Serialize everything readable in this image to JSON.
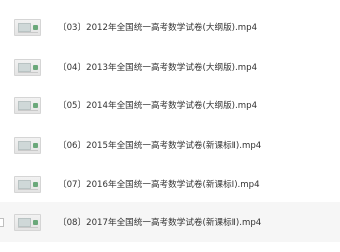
{
  "files": [
    {
      "name": "〔03〕2012年全国统一高考数学试卷(大纲版).mp4",
      "icon": "video-file-icon",
      "selected": false
    },
    {
      "name": "〔04〕2013年全国统一高考数学试卷(大纲版).mp4",
      "icon": "video-file-icon",
      "selected": false
    },
    {
      "name": "〔05〕2014年全国统一高考数学试卷(大纲版).mp4",
      "icon": "video-file-icon",
      "selected": false
    },
    {
      "name": "〔06〕2015年全国统一高考数学试卷(新课标Ⅱ).mp4",
      "icon": "video-file-icon",
      "selected": false
    },
    {
      "name": "〔07〕2016年全国统一高考数学试卷(新课标Ⅰ).mp4",
      "icon": "video-file-icon",
      "selected": false
    },
    {
      "name": "〔08〕2017年全国统一高考数学试卷(新课标Ⅱ).mp4",
      "icon": "video-file-icon",
      "selected": true
    }
  ],
  "colors": {
    "row_hover": "#f6f6f6",
    "text": "#333333"
  }
}
